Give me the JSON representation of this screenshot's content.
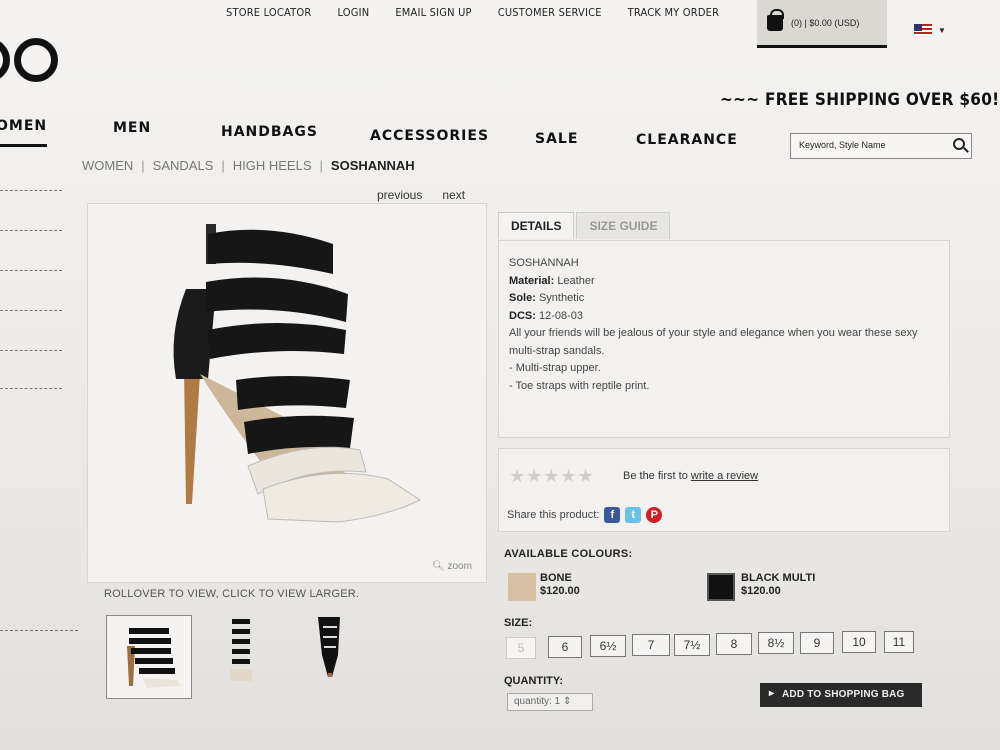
{
  "header": {
    "top_links": [
      "STORE LOCATOR",
      "LOGIN",
      "EMAIL SIGN UP",
      "CUSTOMER SERVICE",
      "TRACK MY ORDER"
    ],
    "bag_summary": "(0) | $0.00 (USD)",
    "free_shipping": "~~~ FREE SHIPPING OVER $60! ~~~"
  },
  "nav": {
    "women": "OMEN",
    "men": "MEN",
    "handbags": "HANDBAGS",
    "accessories": "ACCESSORIES",
    "sale": "SALE",
    "clearance": "CLEARANCE"
  },
  "search": {
    "placeholder": "Keyword, Style Name"
  },
  "breadcrumb": {
    "women": "WOMEN",
    "sandals": "SANDALS",
    "high_heels": "HIGH HEELS",
    "current": "SOSHANNAH"
  },
  "pager": {
    "previous": "previous",
    "next": "next"
  },
  "image": {
    "zoom": "zoom",
    "rollover_hint": "ROLLOVER TO VIEW, CLICK TO VIEW LARGER."
  },
  "tabs": {
    "details": "DETAILS",
    "size_guide": "SIZE GUIDE"
  },
  "details": {
    "name": "SOSHANNAH",
    "material_label": "Material:",
    "material": "Leather",
    "sole_label": "Sole:",
    "sole": "Synthetic",
    "dcs_label": "DCS:",
    "dcs": "12-08-03",
    "description": "All your friends will be jealous of your style and elegance when you wear these sexy multi-strap sandals.",
    "bullet1": "- Multi-strap upper.",
    "bullet2": "- Toe straps with reptile print."
  },
  "review": {
    "stars": "★★★★★",
    "prompt": "Be the first to",
    "link": "write a review",
    "share": "Share this product:"
  },
  "colours": {
    "label": "AVAILABLE COLOURS:",
    "items": [
      {
        "name": "BONE",
        "price": "$120.00",
        "swatch": "#d7bfa3"
      },
      {
        "name": "BLACK MULTI",
        "price": "$120.00",
        "swatch": "#111111"
      }
    ]
  },
  "size": {
    "label": "SIZE:",
    "options": [
      "5",
      "6",
      "6½",
      "7",
      "7½",
      "8",
      "8½",
      "9",
      "10",
      "11"
    ]
  },
  "quantity": {
    "label": "QUANTITY:",
    "value": "quantity: 1"
  },
  "add_to_bag": "ADD TO SHOPPING BAG"
}
